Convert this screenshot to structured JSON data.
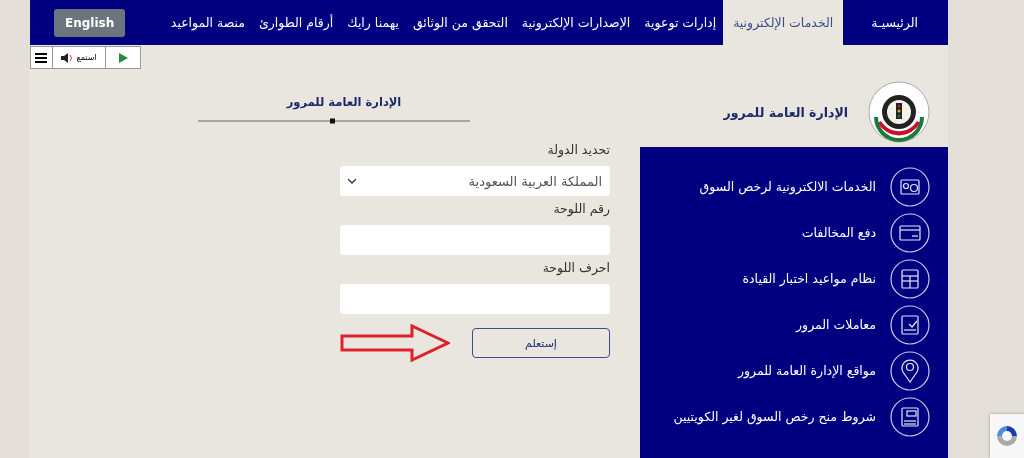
{
  "nav": {
    "items": [
      {
        "label": "الرئيسيـة",
        "selected": false
      },
      {
        "label": "الخدمات الإلكترونية",
        "selected": true
      },
      {
        "label": "إدارات توعوية",
        "selected": false
      },
      {
        "label": "الإصدارات الإلكترونية",
        "selected": false
      },
      {
        "label": "التحقق من الوثائق",
        "selected": false
      },
      {
        "label": "يهمنا رايك",
        "selected": false
      },
      {
        "label": "أرقام الطوارئ",
        "selected": false
      },
      {
        "label": "منصة المواعيد",
        "selected": false
      }
    ],
    "language_button": "English"
  },
  "reader_toolbar": {
    "listen_label": "استمع"
  },
  "header": {
    "title": "الإدارة العامة للمرور"
  },
  "services": [
    {
      "kind": "license",
      "label": "الخدمات الالكترونية لرخص السوق"
    },
    {
      "kind": "card",
      "label": "دفع المخالفات"
    },
    {
      "kind": "calendar",
      "label": "نظام مواعيد اختبار القيادة"
    },
    {
      "kind": "checklist",
      "label": "معاملات المرور"
    },
    {
      "kind": "location",
      "label": "مواقع الإدارة العامة للمرور"
    },
    {
      "kind": "pdf",
      "label": "شروط منح رخص السوق لغير الكويتيين"
    }
  ],
  "form": {
    "title": "الإدارة العامة للمرور",
    "fields": [
      {
        "kind": "select",
        "label": "تحديد الدولة",
        "value": "المملكة العربية السعودية"
      },
      {
        "kind": "text",
        "label": "رقم اللوحة"
      },
      {
        "kind": "text",
        "label": "احرف اللوحة"
      }
    ],
    "submit": "إستعلم"
  }
}
